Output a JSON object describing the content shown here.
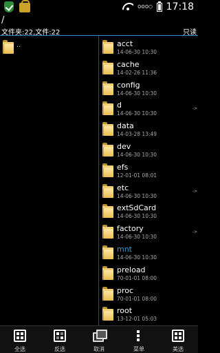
{
  "status_bar": {
    "time": "17:18",
    "signal": "ooo○"
  },
  "header": {
    "path": "/",
    "summary": "文件夹:22,文件:22",
    "mode": "只读"
  },
  "left_pane": {
    "up_label": ".."
  },
  "files": [
    {
      "name": "acct",
      "date": "14-06-30 10:30",
      "link": false
    },
    {
      "name": "cache",
      "date": "14-02-26 11:36",
      "link": false
    },
    {
      "name": "config",
      "date": "14-06-30 10:30",
      "link": false
    },
    {
      "name": "d",
      "date": "14-06-30 10:30",
      "link": true
    },
    {
      "name": "data",
      "date": "14-03-28 13:49",
      "link": false
    },
    {
      "name": "dev",
      "date": "14-06-30 10:30",
      "link": false
    },
    {
      "name": "efs",
      "date": "12-01-01 08:01",
      "link": false
    },
    {
      "name": "etc",
      "date": "14-06-30 10:30",
      "link": true
    },
    {
      "name": "extSdCard",
      "date": "14-06-30 10:30",
      "link": false
    },
    {
      "name": "factory",
      "date": "14-06-30 10:30",
      "link": true
    },
    {
      "name": "mnt",
      "date": "14-06-30 10:30",
      "link": false,
      "highlight": true
    },
    {
      "name": "preload",
      "date": "70-01-01 08:00",
      "link": false
    },
    {
      "name": "proc",
      "date": "70-01-01 08:00",
      "link": false
    },
    {
      "name": "root",
      "date": "13-12-01 05:03",
      "link": false
    }
  ],
  "link_marker": "->",
  "toolbar": {
    "select_all": "全选",
    "invert": "反选",
    "cancel": "取消",
    "menu": "菜单",
    "select": "美选"
  },
  "colors": {
    "accent": "#2b8ec9",
    "highlight_text": "#2f9fd6",
    "folder": "#e9bd52"
  }
}
